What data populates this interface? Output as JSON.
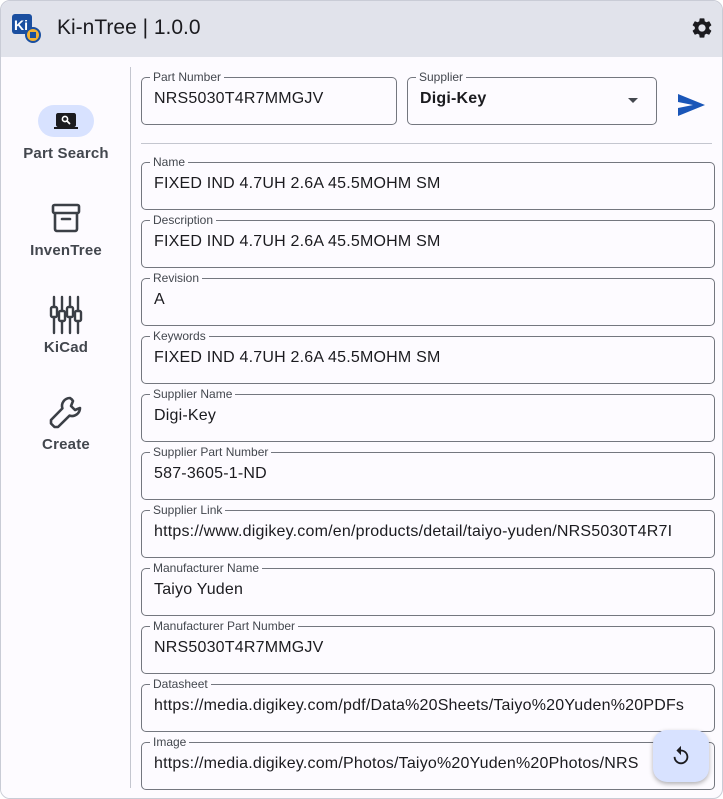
{
  "window": {
    "title": "Ki-nTree | 1.0.0",
    "logo_text": "Ki"
  },
  "rail": {
    "items": [
      {
        "label": "Part Search",
        "icon": "search-laptop-icon",
        "active": true
      },
      {
        "label": "InvenTree",
        "icon": "archive-icon",
        "active": false
      },
      {
        "label": "KiCad",
        "icon": "chip-icon",
        "active": false
      },
      {
        "label": "Create",
        "icon": "wrench-icon",
        "active": false
      }
    ]
  },
  "search": {
    "part_number_label": "Part Number",
    "part_number_value": "NRS5030T4R7MMGJV",
    "supplier_label": "Supplier",
    "supplier_value": "Digi-Key"
  },
  "fields": [
    {
      "label": "Name",
      "value": "FIXED IND 4.7UH 2.6A 45.5MOHM SM"
    },
    {
      "label": "Description",
      "value": "FIXED IND 4.7UH 2.6A 45.5MOHM SM"
    },
    {
      "label": "Revision",
      "value": "A"
    },
    {
      "label": "Keywords",
      "value": "FIXED IND 4.7UH 2.6A 45.5MOHM SM"
    },
    {
      "label": "Supplier Name",
      "value": "Digi-Key"
    },
    {
      "label": "Supplier Part Number",
      "value": "587-3605-1-ND"
    },
    {
      "label": "Supplier Link",
      "value": "https://www.digikey.com/en/products/detail/taiyo-yuden/NRS5030T4R7I"
    },
    {
      "label": "Manufacturer Name",
      "value": "Taiyo Yuden"
    },
    {
      "label": "Manufacturer Part Number",
      "value": "NRS5030T4R7MMGJV"
    },
    {
      "label": "Datasheet",
      "value": "https://media.digikey.com/pdf/Data%20Sheets/Taiyo%20Yuden%20PDFs"
    },
    {
      "label": "Image",
      "value": "https://media.digikey.com/Photos/Taiyo%20Yuden%20Photos/NRS"
    }
  ],
  "colors": {
    "accent": "#1a56b8",
    "titlebar": "#e1e3eb",
    "active_pill": "#d8e2ff",
    "outline": "#74777f"
  }
}
